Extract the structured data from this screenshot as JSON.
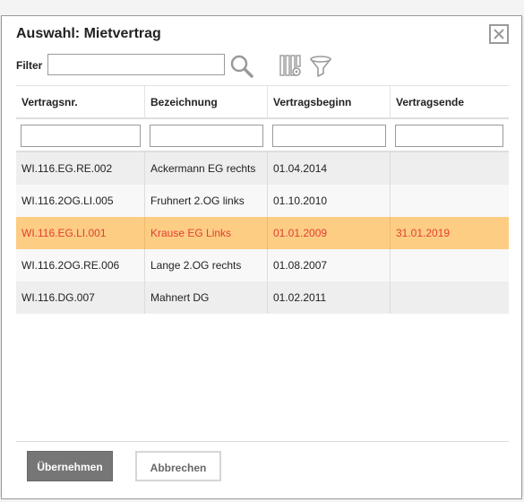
{
  "dialog": {
    "title": "Auswahl: Mietvertrag",
    "filter_label": "Filter",
    "filter_value": "",
    "icons": [
      "close-icon",
      "search-icon",
      "column-settings-icon",
      "funnel-filter-icon"
    ]
  },
  "table": {
    "columns": [
      "Vertragsnr.",
      "Bezeichnung",
      "Vertragsbeginn",
      "Vertragsende"
    ],
    "rows": [
      {
        "nr": "WI.116.EG.RE.002",
        "bez": "Ackermann EG rechts",
        "beginn": "01.04.2014",
        "ende": "",
        "selected": false
      },
      {
        "nr": "WI.116.2OG.LI.005",
        "bez": "Fruhnert 2.OG links",
        "beginn": "01.10.2010",
        "ende": "",
        "selected": false
      },
      {
        "nr": "WI.116.EG.LI.001",
        "bez": "Krause EG Links",
        "beginn": "01.01.2009",
        "ende": "31.01.2019",
        "selected": true
      },
      {
        "nr": "WI.116.2OG.RE.006",
        "bez": "Lange 2.OG rechts",
        "beginn": "01.08.2007",
        "ende": "",
        "selected": false
      },
      {
        "nr": "WI.116.DG.007",
        "bez": "Mahnert DG",
        "beginn": "01.02.2011",
        "ende": "",
        "selected": false
      }
    ]
  },
  "buttons": {
    "ok": "Übernehmen",
    "cancel": "Abbrechen"
  },
  "colors": {
    "selected_row_bg": "#fdcd84",
    "selected_row_text": "#e04030",
    "primary_button": "#767676"
  }
}
